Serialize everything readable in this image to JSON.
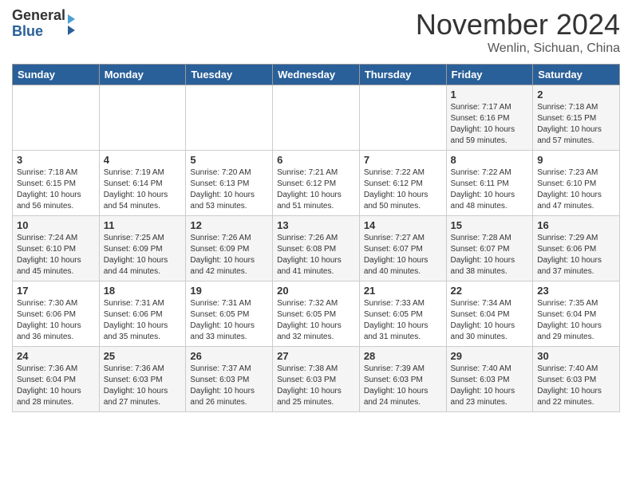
{
  "header": {
    "logo_line1": "General",
    "logo_line2": "Blue",
    "month": "November 2024",
    "location": "Wenlin, Sichuan, China"
  },
  "days_of_week": [
    "Sunday",
    "Monday",
    "Tuesday",
    "Wednesday",
    "Thursday",
    "Friday",
    "Saturday"
  ],
  "weeks": [
    [
      {
        "day": "",
        "info": ""
      },
      {
        "day": "",
        "info": ""
      },
      {
        "day": "",
        "info": ""
      },
      {
        "day": "",
        "info": ""
      },
      {
        "day": "",
        "info": ""
      },
      {
        "day": "1",
        "info": "Sunrise: 7:17 AM\nSunset: 6:16 PM\nDaylight: 10 hours and 59 minutes."
      },
      {
        "day": "2",
        "info": "Sunrise: 7:18 AM\nSunset: 6:15 PM\nDaylight: 10 hours and 57 minutes."
      }
    ],
    [
      {
        "day": "3",
        "info": "Sunrise: 7:18 AM\nSunset: 6:15 PM\nDaylight: 10 hours and 56 minutes."
      },
      {
        "day": "4",
        "info": "Sunrise: 7:19 AM\nSunset: 6:14 PM\nDaylight: 10 hours and 54 minutes."
      },
      {
        "day": "5",
        "info": "Sunrise: 7:20 AM\nSunset: 6:13 PM\nDaylight: 10 hours and 53 minutes."
      },
      {
        "day": "6",
        "info": "Sunrise: 7:21 AM\nSunset: 6:12 PM\nDaylight: 10 hours and 51 minutes."
      },
      {
        "day": "7",
        "info": "Sunrise: 7:22 AM\nSunset: 6:12 PM\nDaylight: 10 hours and 50 minutes."
      },
      {
        "day": "8",
        "info": "Sunrise: 7:22 AM\nSunset: 6:11 PM\nDaylight: 10 hours and 48 minutes."
      },
      {
        "day": "9",
        "info": "Sunrise: 7:23 AM\nSunset: 6:10 PM\nDaylight: 10 hours and 47 minutes."
      }
    ],
    [
      {
        "day": "10",
        "info": "Sunrise: 7:24 AM\nSunset: 6:10 PM\nDaylight: 10 hours and 45 minutes."
      },
      {
        "day": "11",
        "info": "Sunrise: 7:25 AM\nSunset: 6:09 PM\nDaylight: 10 hours and 44 minutes."
      },
      {
        "day": "12",
        "info": "Sunrise: 7:26 AM\nSunset: 6:09 PM\nDaylight: 10 hours and 42 minutes."
      },
      {
        "day": "13",
        "info": "Sunrise: 7:26 AM\nSunset: 6:08 PM\nDaylight: 10 hours and 41 minutes."
      },
      {
        "day": "14",
        "info": "Sunrise: 7:27 AM\nSunset: 6:07 PM\nDaylight: 10 hours and 40 minutes."
      },
      {
        "day": "15",
        "info": "Sunrise: 7:28 AM\nSunset: 6:07 PM\nDaylight: 10 hours and 38 minutes."
      },
      {
        "day": "16",
        "info": "Sunrise: 7:29 AM\nSunset: 6:06 PM\nDaylight: 10 hours and 37 minutes."
      }
    ],
    [
      {
        "day": "17",
        "info": "Sunrise: 7:30 AM\nSunset: 6:06 PM\nDaylight: 10 hours and 36 minutes."
      },
      {
        "day": "18",
        "info": "Sunrise: 7:31 AM\nSunset: 6:06 PM\nDaylight: 10 hours and 35 minutes."
      },
      {
        "day": "19",
        "info": "Sunrise: 7:31 AM\nSunset: 6:05 PM\nDaylight: 10 hours and 33 minutes."
      },
      {
        "day": "20",
        "info": "Sunrise: 7:32 AM\nSunset: 6:05 PM\nDaylight: 10 hours and 32 minutes."
      },
      {
        "day": "21",
        "info": "Sunrise: 7:33 AM\nSunset: 6:05 PM\nDaylight: 10 hours and 31 minutes."
      },
      {
        "day": "22",
        "info": "Sunrise: 7:34 AM\nSunset: 6:04 PM\nDaylight: 10 hours and 30 minutes."
      },
      {
        "day": "23",
        "info": "Sunrise: 7:35 AM\nSunset: 6:04 PM\nDaylight: 10 hours and 29 minutes."
      }
    ],
    [
      {
        "day": "24",
        "info": "Sunrise: 7:36 AM\nSunset: 6:04 PM\nDaylight: 10 hours and 28 minutes."
      },
      {
        "day": "25",
        "info": "Sunrise: 7:36 AM\nSunset: 6:03 PM\nDaylight: 10 hours and 27 minutes."
      },
      {
        "day": "26",
        "info": "Sunrise: 7:37 AM\nSunset: 6:03 PM\nDaylight: 10 hours and 26 minutes."
      },
      {
        "day": "27",
        "info": "Sunrise: 7:38 AM\nSunset: 6:03 PM\nDaylight: 10 hours and 25 minutes."
      },
      {
        "day": "28",
        "info": "Sunrise: 7:39 AM\nSunset: 6:03 PM\nDaylight: 10 hours and 24 minutes."
      },
      {
        "day": "29",
        "info": "Sunrise: 7:40 AM\nSunset: 6:03 PM\nDaylight: 10 hours and 23 minutes."
      },
      {
        "day": "30",
        "info": "Sunrise: 7:40 AM\nSunset: 6:03 PM\nDaylight: 10 hours and 22 minutes."
      }
    ]
  ]
}
